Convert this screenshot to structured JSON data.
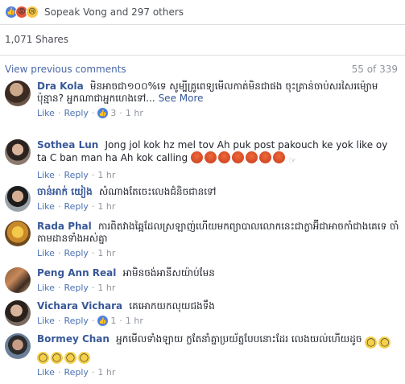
{
  "reactions": {
    "summary": "Sopeak Vong and 297 others",
    "icons": [
      "like-icon",
      "angry-icon",
      "sad-icon"
    ]
  },
  "shares": "1,071 Shares",
  "comments_header": {
    "view_previous": "View previous comments",
    "count": "55 of 339"
  },
  "actions": {
    "like": "Like",
    "reply": "Reply",
    "sep": "·"
  },
  "comments": [
    {
      "author": "Dra Kola",
      "text": "មិនអាចជា១០០%ទេ សូម្បីគ្រូពេទ្យមើលកាត់មិនជាផង ចុះគ្រាន់ចាប់សរសៃរម៉្យោមប៉ុន្មាន? អ្នកណាជាអ្នកហេងទៅ...",
      "see_more": "See More",
      "likes": "3",
      "time": "1 hr"
    },
    {
      "author": "Sothea Lun",
      "text": "Jong jol kok hz mel tov Ah puk post pakouch ke yok like oy ta C ban man ha Ah kok calling",
      "time": "1 hr"
    },
    {
      "author": "ចាន់អាក់ យៀង",
      "text": "សំណាងតែចេះលេងជំនិចជានទៅ",
      "time": "1 hr"
    },
    {
      "author": "Rada Phal",
      "text": "ការពិតវាងឆ្អៃដែលស្រឡាញ់ហើយមកព្យាបាលលោកនេះ​ជាក្លាអ៊ីជាអាចកាំជាងគេទេ ចាំតាមដានទាំងអស់គ្នា",
      "time": "1 hr"
    },
    {
      "author": "Peng Ann Real",
      "text": "អាមិនចង់អានីសយ៉ាប់មែន",
      "time": "1 hr"
    },
    {
      "author": "Vichara Vichara",
      "text": "គេអោកយកលុយជងទឹង",
      "likes": "1",
      "time": "1 hr"
    },
    {
      "author": "Bormey Chan",
      "text": "អ្នកមើលទាំងឡាយ ក្លតែនាំគ្នាប្រយ័ត្នបែបនោះដែរ លេងយល់ហើយដូច",
      "time": "1 hr"
    }
  ],
  "colors": {
    "link": "#385898",
    "meta_link": "#4b72b4",
    "muted": "#90949c",
    "divider": "#dddfe2"
  }
}
